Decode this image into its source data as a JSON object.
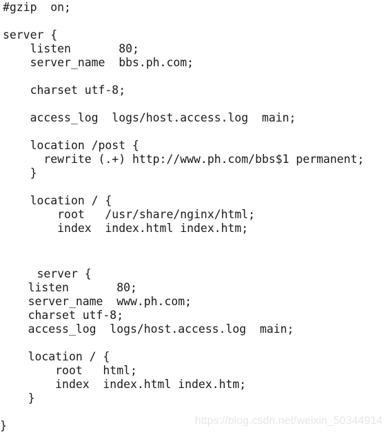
{
  "document": {
    "lines": [
      "#gzip  on;",
      "",
      "server {",
      "    listen       80;",
      "    server_name  bbs.ph.com;",
      "",
      "    charset utf-8;",
      "",
      "    access_log  logs/host.access.log  main;",
      "",
      "    location /post {",
      "      rewrite (.+) http://www.ph.com/bbs$1 permanent;",
      "    }",
      "",
      "    location / {",
      "        root   /usr/share/nginx/html;",
      "        index  index.html index.htm;",
      "",
      "",
      "",
      "     server {",
      "    listen       80;",
      "    server_name  www.ph.com;",
      "    charset utf-8;",
      "    access_log  logs/host.access.log  main;",
      "",
      "    location / {",
      "        root   html;",
      "        index  index.html index.htm;",
      "    }",
      "",
      "}"
    ]
  },
  "watermark": "https://blog.csdn.net/weixin_50344914"
}
